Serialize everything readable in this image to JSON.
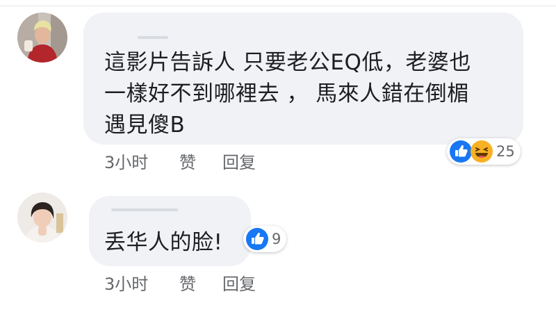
{
  "comments": [
    {
      "text": "這影片告訴人 只要老公EQ低，老婆也\n一樣好不到哪裡去 ， 馬來人錯在倒楣\n遇見傻B",
      "time": "3小时",
      "like_label": "赞",
      "reply_label": "回复",
      "reaction_count": "25",
      "reactions": [
        "like-icon",
        "haha-icon"
      ]
    },
    {
      "text": "丢华人的脸!",
      "time": "3小时",
      "like_label": "赞",
      "reply_label": "回复",
      "reaction_count": "9",
      "reactions": [
        "like-icon"
      ]
    }
  ],
  "colors": {
    "bubble": "#f0f2f5",
    "like_blue": "#1877f2",
    "haha_yellow": "#f7b125",
    "meta_gray": "#65676b"
  }
}
